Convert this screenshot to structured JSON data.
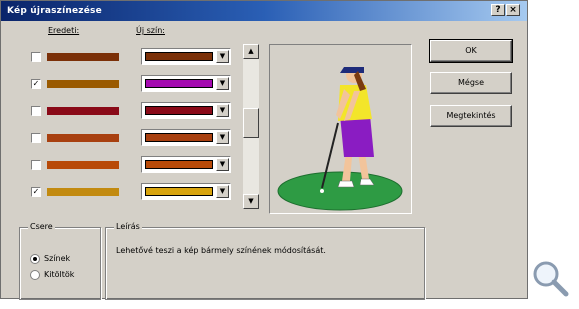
{
  "window": {
    "title": "Kép újraszínezése"
  },
  "titlebar_buttons": {
    "help": "?",
    "close": "×"
  },
  "columns": {
    "original": "Eredeti:",
    "new_color": "Új szín:"
  },
  "rows": [
    {
      "checked": false,
      "check_mark": "",
      "orig_color": "#7b3008",
      "new_color": "#7b3008"
    },
    {
      "checked": true,
      "check_mark": "✓",
      "orig_color": "#9a5a00",
      "new_color": "#a40ab0"
    },
    {
      "checked": false,
      "check_mark": "",
      "orig_color": "#8a0a18",
      "new_color": "#8a0a18"
    },
    {
      "checked": false,
      "check_mark": "",
      "orig_color": "#a84010",
      "new_color": "#a84010"
    },
    {
      "checked": false,
      "check_mark": "",
      "orig_color": "#b84a08",
      "new_color": "#b84a08"
    },
    {
      "checked": true,
      "check_mark": "✓",
      "orig_color": "#c28a10",
      "new_color": "#d8a40e"
    }
  ],
  "scroll": {
    "up": "▲",
    "down": "▼"
  },
  "combo_arrow": "▼",
  "buttons": {
    "ok": "OK",
    "cancel": "Mégse",
    "help": "Megtekintés"
  },
  "replace_group": {
    "legend": "Csere",
    "options": [
      {
        "label": "Színek",
        "selected": true
      },
      {
        "label": "Kitöltök",
        "selected": false
      }
    ]
  },
  "description_group": {
    "legend": "Leírás",
    "text": "Lehetővé teszi a kép bármely színének módosítását."
  },
  "icons": {
    "magnifier": "magnifier-icon"
  }
}
